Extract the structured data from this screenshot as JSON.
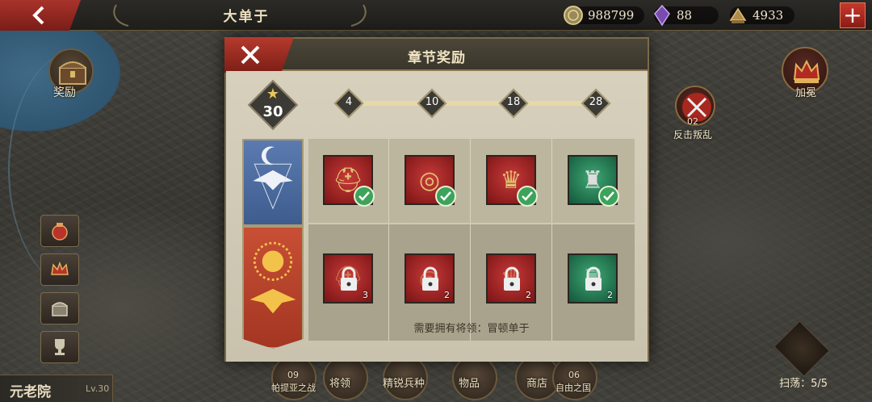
{
  "topbar": {
    "title": "大单于",
    "resources": [
      {
        "icon": "coin-icon",
        "value": "988799"
      },
      {
        "icon": "gem-icon",
        "value": "88"
      },
      {
        "icon": "food-icon",
        "value": "4933"
      }
    ],
    "plus": "+"
  },
  "left": {
    "reward_label": "奖励",
    "buttons": [
      "bag-icon",
      "crown-icon",
      "chest-icon",
      "trophy-icon"
    ],
    "senate_name": "元老院",
    "senate_level": "Lv.30"
  },
  "right": {
    "coronation_label": "加冕",
    "rebel_number": "02",
    "rebel_label": "反击叛乱",
    "sweep_label": "扫荡：5/5"
  },
  "bottom_tabs": [
    {
      "num": "09",
      "label": "帕提亚之战"
    },
    {
      "label": "将领"
    },
    {
      "label": "精锐兵种"
    },
    {
      "label": "物品"
    },
    {
      "label": "商店"
    },
    {
      "num": "06",
      "label": "自由之国"
    }
  ],
  "modal": {
    "title": "章节奖励",
    "stars": "30",
    "milestones": [
      "4",
      "10",
      "18",
      "28"
    ],
    "row1": [
      {
        "icon": "helmet-icon",
        "color": "red",
        "claimed": true
      },
      {
        "icon": "ring-icon",
        "color": "red",
        "claimed": true
      },
      {
        "icon": "crown-icon",
        "color": "red",
        "claimed": true
      },
      {
        "icon": "armor-icon",
        "color": "green",
        "claimed": true
      }
    ],
    "row2": [
      {
        "icon": "helmet-icon",
        "color": "red",
        "count": "3"
      },
      {
        "icon": "ring-icon",
        "color": "red",
        "count": "2"
      },
      {
        "icon": "crown-icon",
        "color": "red",
        "count": "2"
      },
      {
        "icon": "armor-icon",
        "color": "green",
        "count": "2"
      }
    ],
    "requirement": "需要拥有将领：冒顿单于"
  }
}
